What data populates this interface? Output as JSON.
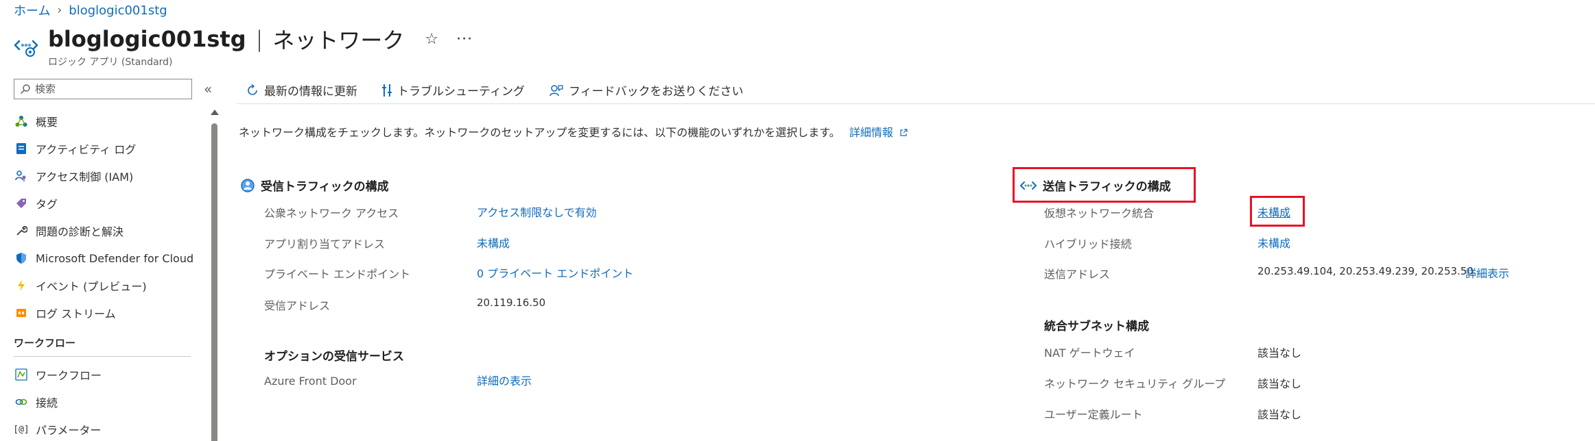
{
  "breadcrumb": {
    "home": "ホーム",
    "current": "bloglogic001stg"
  },
  "header": {
    "title": "bloglogic001stg",
    "separator": "|",
    "page": "ネットワーク",
    "subtitle": "ロジック アプリ (Standard)",
    "star": "☆",
    "more": "···"
  },
  "sidebar": {
    "search_placeholder": "検索",
    "collapse": "«",
    "items": [
      {
        "label": "概要",
        "icon": "overview-icon"
      },
      {
        "label": "アクティビティ ログ",
        "icon": "activity-log-icon"
      },
      {
        "label": "アクセス制御 (IAM)",
        "icon": "iam-icon"
      },
      {
        "label": "タグ",
        "icon": "tag-icon"
      },
      {
        "label": "問題の診断と解決",
        "icon": "wrench-icon"
      },
      {
        "label": "Microsoft Defender for Cloud",
        "icon": "shield-icon"
      },
      {
        "label": "イベント (プレビュー)",
        "icon": "lightning-icon"
      },
      {
        "label": "ログ ストリーム",
        "icon": "log-stream-icon"
      }
    ],
    "section_workflow": "ワークフロー",
    "workflow_items": [
      {
        "label": "ワークフロー",
        "icon": "workflow-icon"
      },
      {
        "label": "接続",
        "icon": "connection-icon"
      },
      {
        "label": "パラメーター",
        "icon": "parameter-icon"
      }
    ]
  },
  "toolbar": {
    "refresh": "最新の情報に更新",
    "troubleshoot": "トラブルシューティング",
    "feedback": "フィードバックをお送りください"
  },
  "intro": {
    "text": "ネットワーク構成をチェックします。ネットワークのセットアップを変更するには、以下の機能のいずれかを選択します。",
    "link": "詳細情報"
  },
  "inbound": {
    "title": "受信トラフィックの構成",
    "rows": [
      {
        "label": "公衆ネットワーク アクセス",
        "value": "アクセス制限なしで有効"
      },
      {
        "label": "アプリ割り当てアドレス",
        "value": "未構成"
      },
      {
        "label": "プライベート エンドポイント",
        "value": "0 プライベート エンドポイント"
      },
      {
        "label": "受信アドレス",
        "value": "20.119.16.50"
      }
    ]
  },
  "optional_inbound": {
    "title": "オプションの受信サービス",
    "rows": [
      {
        "label": "Azure Front Door",
        "value": "詳細の表示"
      }
    ]
  },
  "outbound": {
    "title": "送信トラフィックの構成",
    "rows": [
      {
        "label": "仮想ネットワーク統合",
        "value": "未構成"
      },
      {
        "label": "ハイブリッド接続",
        "value": "未構成"
      },
      {
        "label": "送信アドレス",
        "value": "20.253.49.104, 20.253.49.239, 20.253.50...",
        "extra_link": "詳細表示"
      }
    ]
  },
  "subnet": {
    "title": "統合サブネット構成",
    "rows": [
      {
        "label": "NAT ゲートウェイ",
        "value": "該当なし"
      },
      {
        "label": "ネットワーク セキュリティ グループ",
        "value": "該当なし"
      },
      {
        "label": "ユーザー定義ルート",
        "value": "該当なし"
      }
    ]
  },
  "colors": {
    "link": "#0f6cbd",
    "highlight": "#e81123",
    "text": "#323130",
    "muted": "#605e5c"
  }
}
